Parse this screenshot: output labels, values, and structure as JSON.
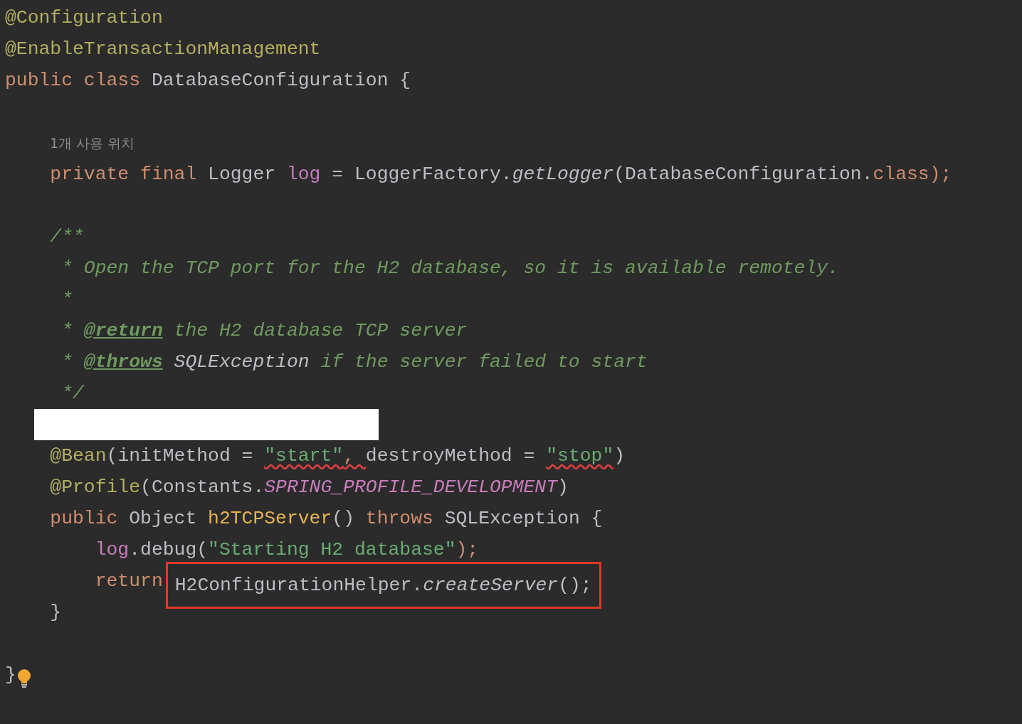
{
  "editor": {
    "lines": [
      {
        "kind": "code",
        "tokens": [
          {
            "text": "@Configuration",
            "kind": "annotation"
          }
        ]
      },
      {
        "kind": "code",
        "tokens": [
          {
            "text": "@EnableTransactionManagement",
            "kind": "annotation"
          }
        ]
      },
      {
        "kind": "code",
        "tokens": [
          {
            "text": "public class ",
            "kind": "keyword"
          },
          {
            "text": "DatabaseConfiguration {",
            "kind": "plain"
          }
        ]
      },
      {
        "kind": "blank"
      },
      {
        "kind": "hint",
        "text": "1개 사용 위치"
      },
      {
        "kind": "code",
        "tokens": [
          {
            "text": "    private final ",
            "kind": "keyword"
          },
          {
            "text": "Logger ",
            "kind": "plain"
          },
          {
            "text": "log",
            "kind": "field"
          },
          {
            "text": " = LoggerFactory.",
            "kind": "plain"
          },
          {
            "text": "getLogger",
            "kind": "call"
          },
          {
            "text": "(DatabaseConfiguration.",
            "kind": "plain"
          },
          {
            "text": "class",
            "kind": "keyword"
          },
          {
            "text": ");",
            "kind": "keyword"
          }
        ]
      },
      {
        "kind": "blank"
      },
      {
        "kind": "code",
        "tokens": [
          {
            "text": "    /**",
            "kind": "comment"
          }
        ]
      },
      {
        "kind": "code",
        "tokens": [
          {
            "text": "     * Open the TCP port for the H2 database, so it is available remotely.",
            "kind": "comment"
          }
        ]
      },
      {
        "kind": "code",
        "tokens": [
          {
            "text": "     *",
            "kind": "comment"
          }
        ]
      },
      {
        "kind": "code",
        "tokens": [
          {
            "text": "     * ",
            "kind": "comment"
          },
          {
            "text": "@return",
            "kind": "tag"
          },
          {
            "text": " the H2 database TCP server",
            "kind": "comment"
          }
        ]
      },
      {
        "kind": "code",
        "tokens": [
          {
            "text": "     * ",
            "kind": "comment"
          },
          {
            "text": "@throws",
            "kind": "tag"
          },
          {
            "text": " SQLException",
            "kind": "reference"
          },
          {
            "text": " if the server failed to start",
            "kind": "comment"
          }
        ]
      },
      {
        "kind": "code",
        "tokens": [
          {
            "text": "     */",
            "kind": "comment"
          }
        ]
      },
      {
        "kind": "redacted"
      },
      {
        "kind": "code",
        "tokens": [
          {
            "text": "    @Bean",
            "kind": "annotation"
          },
          {
            "text": "(initMethod = ",
            "kind": "plain"
          },
          {
            "text": "\"start\"",
            "kind": "string",
            "squiggle": true
          },
          {
            "text": ", ",
            "kind": "keyword",
            "squiggle": true
          },
          {
            "text": "destroyMethod = ",
            "kind": "plain"
          },
          {
            "text": "\"stop\"",
            "kind": "string",
            "squiggle": true
          },
          {
            "text": ")",
            "kind": "plain"
          }
        ]
      },
      {
        "kind": "code",
        "tokens": [
          {
            "text": "    @Profile",
            "kind": "annotation"
          },
          {
            "text": "(Constants.",
            "kind": "plain"
          },
          {
            "text": "SPRING_PROFILE_DEVELOPMENT",
            "kind": "constant"
          },
          {
            "text": ")",
            "kind": "plain"
          }
        ]
      },
      {
        "kind": "code",
        "tokens": [
          {
            "text": "    public ",
            "kind": "keyword"
          },
          {
            "text": "Object ",
            "kind": "plain"
          },
          {
            "text": "h2TCPServer",
            "kind": "method"
          },
          {
            "text": "() ",
            "kind": "plain"
          },
          {
            "text": "throws ",
            "kind": "keyword"
          },
          {
            "text": "SQLException {",
            "kind": "plain"
          }
        ]
      },
      {
        "kind": "code",
        "tokens": [
          {
            "text": "        log",
            "kind": "field"
          },
          {
            "text": ".debug(",
            "kind": "plain"
          },
          {
            "text": "\"Starting H2 database\"",
            "kind": "string"
          },
          {
            "text": ");",
            "kind": "keyword"
          }
        ]
      },
      {
        "kind": "code",
        "tokens": [
          {
            "text": "        return",
            "kind": "keyword"
          },
          {
            "text": "H2ConfigurationHelper.",
            "kind": "plain",
            "boxed": true
          },
          {
            "text": "createServer",
            "kind": "call",
            "boxed": true
          },
          {
            "text": "();",
            "kind": "plain",
            "boxed": true
          }
        ]
      },
      {
        "kind": "code",
        "tokens": [
          {
            "text": "    }",
            "kind": "plain"
          }
        ]
      },
      {
        "kind": "blank"
      },
      {
        "kind": "code",
        "bulb": true,
        "tokens": [
          {
            "text": "}",
            "kind": "plain"
          }
        ]
      }
    ]
  }
}
